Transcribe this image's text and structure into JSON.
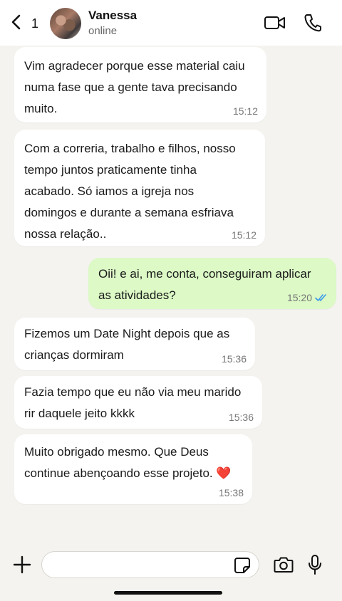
{
  "header": {
    "back_count": "1",
    "contact_name": "Vanessa",
    "status": "online"
  },
  "messages": [
    {
      "direction": "in",
      "text_lines": [
        "Vim agradecer porque esse material caiu",
        "numa fase que a gente tava precisando",
        "muito."
      ],
      "time": "15:12"
    },
    {
      "direction": "in",
      "text_lines": [
        "Com a correria, trabalho e filhos, nosso",
        "tempo juntos praticamente tinha",
        "acabado. Só iamos a igreja nos",
        "domingos e durante a semana esfriava",
        "nossa relação.."
      ],
      "time": "15:12"
    },
    {
      "direction": "out",
      "text_lines": [
        "Oii! e ai, me conta, conseguiram aplicar",
        "as atividades?"
      ],
      "time": "15:20",
      "read": true
    },
    {
      "direction": "in",
      "text_lines": [
        "Fizemos um Date Night depois que as",
        "crianças dormiram"
      ],
      "time": "15:36"
    },
    {
      "direction": "in",
      "text_lines": [
        "Fazia tempo que eu não via meu marido",
        "rir daquele jeito kkkk"
      ],
      "time": "15:36"
    },
    {
      "direction": "in",
      "text_lines": [
        "Muito obrigado mesmo. Que Deus",
        "continue abençoando esse projeto."
      ],
      "emoji": "❤️",
      "time": "15:38"
    }
  ],
  "input": {
    "value": "",
    "placeholder": ""
  },
  "icons": {
    "back": "chevron-left-icon",
    "video": "video-camera-icon",
    "call": "phone-icon",
    "plus": "plus-icon",
    "sticker": "sticker-icon",
    "camera": "camera-icon",
    "mic": "microphone-icon",
    "ticks": "double-check-icon"
  },
  "colors": {
    "incoming_bubble": "#ffffff",
    "outgoing_bubble": "#dcf9c6",
    "read_ticks": "#3d9be9",
    "background": "#f4f3ef"
  }
}
